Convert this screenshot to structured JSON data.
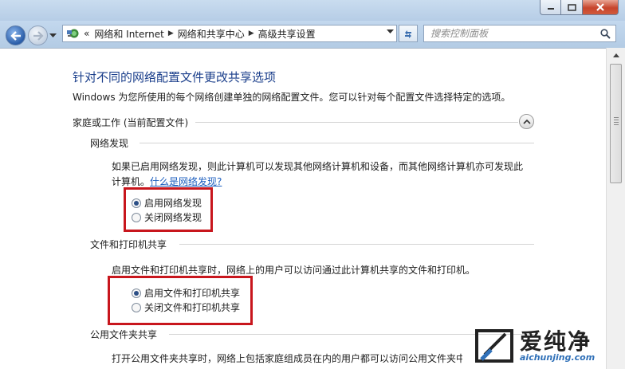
{
  "window": {
    "min_label": "",
    "max_label": "",
    "close_label": ""
  },
  "address": {
    "nav_prefix": "«",
    "crumbs": [
      "网络和 Internet",
      "网络和共享中心",
      "高级共享设置"
    ]
  },
  "search": {
    "placeholder": "搜索控制面板"
  },
  "page": {
    "title": "针对不同的网络配置文件更改共享选项",
    "description": "Windows 为您所使用的每个网络创建单独的网络配置文件。您可以针对每个配置文件选择特定的选项。",
    "profile_header": "家庭或工作 (当前配置文件)"
  },
  "network_discovery": {
    "heading": "网络发现",
    "text_line1": "如果已启用网络发现，则此计算机可以发现其他网络计算机和设备，而其他网络计算机亦可发现此",
    "text_line2_prefix": "计算机。",
    "link": "什么是网络发现?",
    "options": [
      {
        "label": "启用网络发现",
        "selected": true
      },
      {
        "label": "关闭网络发现",
        "selected": false
      }
    ]
  },
  "file_printer_sharing": {
    "heading": "文件和打印机共享",
    "text": "启用文件和打印机共享时，网络上的用户可以访问通过此计算机共享的文件和打印机。",
    "options": [
      {
        "label": "启用文件和打印机共享",
        "selected": true
      },
      {
        "label": "关闭文件和打印机共享",
        "selected": false
      }
    ]
  },
  "public_folder_sharing": {
    "heading": "公用文件夹共享",
    "text": "打开公用文件夹共享时，网络上包括家庭组成员在内的用户都可以访问公用文件夹中的"
  },
  "watermark": {
    "brand": "爱纯净",
    "url": "aichunjing.com"
  },
  "colors": {
    "highlight": "#c8161d",
    "title": "#1a3e8b",
    "link": "#1d5fbf"
  }
}
